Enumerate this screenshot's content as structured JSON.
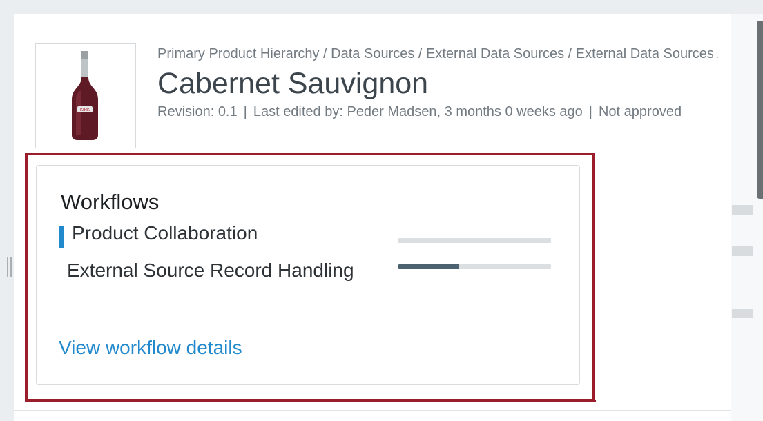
{
  "product": {
    "breadcrumb": "Primary Product Hierarchy / Data Sources / External Data Sources / External Data Sources / Cabernet Sauvignon",
    "title": "Cabernet Sauvignon",
    "revision": "Revision: 0.1",
    "last_edited": "Last edited by: Peder Madsen, 3 months 0 weeks ago",
    "approval_status": "Not approved",
    "bottle_label": "KIRK"
  },
  "workflows": {
    "title": "Workflows",
    "items": [
      {
        "label": "Product Collaboration",
        "progress": 0,
        "selected": true
      },
      {
        "label": "External Source Record Handling",
        "progress": 0.4,
        "selected": false
      }
    ],
    "details_link": "View workflow details"
  },
  "colors": {
    "accent": "#2289cc",
    "highlight_border": "#9b1c2a",
    "progress_fill": "#4d6270",
    "progress_track": "#dbdfe2",
    "title_text": "#3c454c"
  }
}
